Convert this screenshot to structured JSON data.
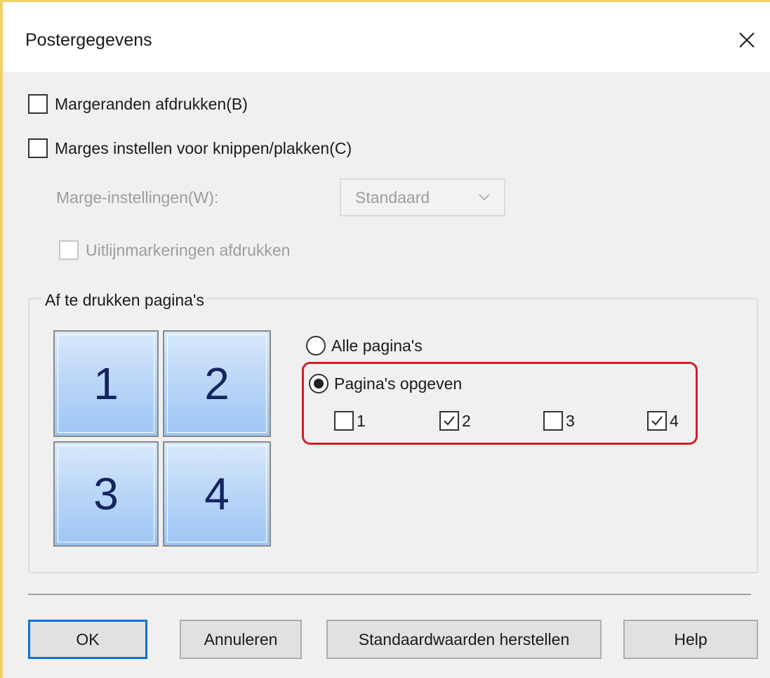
{
  "dialog": {
    "title": "Postergegevens",
    "close_icon": "close-icon",
    "accent_color": "#0a74d6",
    "highlight_color": "#cf1f27"
  },
  "options": {
    "print_margin_borders": {
      "label": "Margeranden afdrukken(B)",
      "checked": false
    },
    "cut_paste_margins": {
      "label": "Marges instellen voor knippen/plakken(C)",
      "checked": false
    },
    "margin_settings": {
      "label": "Marge-instellingen(W):",
      "value": "Standaard",
      "enabled": false
    },
    "alignment_marks": {
      "label": "Uitlijnmarkeringen afdrukken",
      "checked": false,
      "enabled": false
    }
  },
  "pages_group": {
    "legend": "Af te drukken pagina's",
    "tiles": [
      "1",
      "2",
      "3",
      "4"
    ],
    "all_pages": {
      "label": "Alle pagina's",
      "selected": false
    },
    "specify_pages": {
      "label": "Pagina's opgeven",
      "selected": true
    },
    "page_checkboxes": [
      {
        "label": "1",
        "checked": false
      },
      {
        "label": "2",
        "checked": true
      },
      {
        "label": "3",
        "checked": false
      },
      {
        "label": "4",
        "checked": true
      }
    ]
  },
  "buttons": {
    "ok": "OK",
    "cancel": "Annuleren",
    "restore_defaults": "Standaardwaarden herstellen",
    "help": "Help"
  }
}
